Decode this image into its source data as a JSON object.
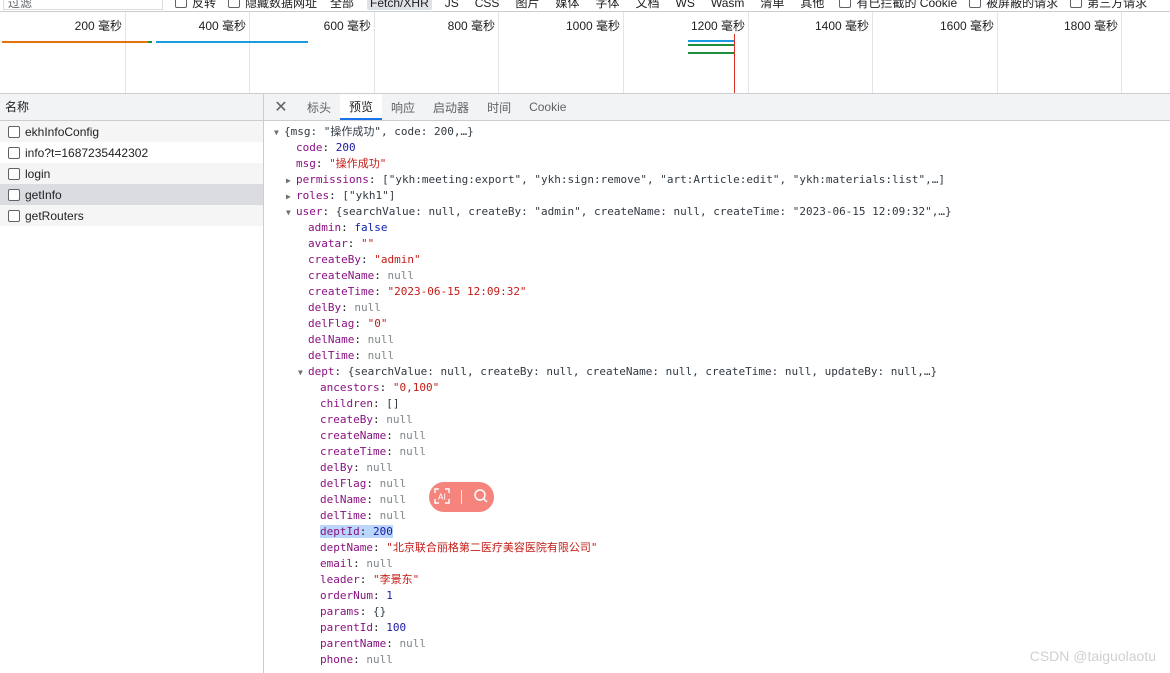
{
  "filter": {
    "placeholder": "过滤",
    "invert_label": "反转",
    "hide_data_urls_label": "隐藏数据网址",
    "types": [
      "全部",
      "Fetch/XHR",
      "JS",
      "CSS",
      "图片",
      "媒体",
      "字体",
      "文档",
      "WS",
      "Wasm",
      "清单",
      "其他"
    ],
    "selected_type": "Fetch/XHR",
    "blocked_cookies_label": "有已拦截的 Cookie",
    "blocked_requests_label": "被屏蔽的请求",
    "third_party_label": "第三方请求"
  },
  "overview": {
    "ticks": [
      "200 毫秒",
      "400 毫秒",
      "600 毫秒",
      "800 毫秒",
      "1000 毫秒",
      "1200 毫秒",
      "1400 毫秒",
      "1600 毫秒",
      "1800 毫秒"
    ],
    "colors": {
      "orange": "#e8710a",
      "blue": "#1a9ae0",
      "green": "#1e8e3e",
      "red": "#d93025"
    }
  },
  "requests": {
    "header": "名称",
    "items": [
      {
        "name": "ekhInfoConfig",
        "selected": false
      },
      {
        "name": "info?t=1687235442302",
        "selected": false
      },
      {
        "name": "login",
        "selected": false
      },
      {
        "name": "getInfo",
        "selected": true
      },
      {
        "name": "getRouters",
        "selected": false
      }
    ]
  },
  "tabs": {
    "close_icon": "close-icon",
    "items": [
      "标头",
      "预览",
      "响应",
      "启动器",
      "时间",
      "Cookie"
    ],
    "active": "预览"
  },
  "preview": {
    "lines": [
      {
        "indent": 0,
        "arrow": "down",
        "key": "",
        "summary": "{msg: \"操作成功\", code: 200,…}"
      },
      {
        "indent": 1,
        "arrow": "",
        "key": "code",
        "value": "200",
        "type": "num"
      },
      {
        "indent": 1,
        "arrow": "",
        "key": "msg",
        "value": "\"操作成功\"",
        "type": "str"
      },
      {
        "indent": 1,
        "arrow": "right",
        "key": "permissions",
        "summary": "[\"ykh:meeting:export\", \"ykh:sign:remove\", \"art:Article:edit\", \"ykh:materials:list\",…]"
      },
      {
        "indent": 1,
        "arrow": "right",
        "key": "roles",
        "summary": "[\"ykh1\"]"
      },
      {
        "indent": 1,
        "arrow": "down",
        "key": "user",
        "summary": "{searchValue: null, createBy: \"admin\", createName: null, createTime: \"2023-06-15 12:09:32\",…}"
      },
      {
        "indent": 2,
        "arrow": "",
        "key": "admin",
        "value": "false",
        "type": "bool"
      },
      {
        "indent": 2,
        "arrow": "",
        "key": "avatar",
        "value": "\"\"",
        "type": "str"
      },
      {
        "indent": 2,
        "arrow": "",
        "key": "createBy",
        "value": "\"admin\"",
        "type": "str"
      },
      {
        "indent": 2,
        "arrow": "",
        "key": "createName",
        "value": "null",
        "type": "null"
      },
      {
        "indent": 2,
        "arrow": "",
        "key": "createTime",
        "value": "\"2023-06-15 12:09:32\"",
        "type": "str"
      },
      {
        "indent": 2,
        "arrow": "",
        "key": "delBy",
        "value": "null",
        "type": "null"
      },
      {
        "indent": 2,
        "arrow": "",
        "key": "delFlag",
        "value": "\"0\"",
        "type": "str"
      },
      {
        "indent": 2,
        "arrow": "",
        "key": "delName",
        "value": "null",
        "type": "null"
      },
      {
        "indent": 2,
        "arrow": "",
        "key": "delTime",
        "value": "null",
        "type": "null"
      },
      {
        "indent": 2,
        "arrow": "down",
        "key": "dept",
        "summary": "{searchValue: null, createBy: null, createName: null, createTime: null, updateBy: null,…}"
      },
      {
        "indent": 3,
        "arrow": "",
        "key": "ancestors",
        "value": "\"0,100\"",
        "type": "str"
      },
      {
        "indent": 3,
        "arrow": "",
        "key": "children",
        "value": "[]",
        "type": "plain"
      },
      {
        "indent": 3,
        "arrow": "",
        "key": "createBy",
        "value": "null",
        "type": "null"
      },
      {
        "indent": 3,
        "arrow": "",
        "key": "createName",
        "value": "null",
        "type": "null"
      },
      {
        "indent": 3,
        "arrow": "",
        "key": "createTime",
        "value": "null",
        "type": "null"
      },
      {
        "indent": 3,
        "arrow": "",
        "key": "delBy",
        "value": "null",
        "type": "null"
      },
      {
        "indent": 3,
        "arrow": "",
        "key": "delFlag",
        "value": "null",
        "type": "null"
      },
      {
        "indent": 3,
        "arrow": "",
        "key": "delName",
        "value": "null",
        "type": "null"
      },
      {
        "indent": 3,
        "arrow": "",
        "key": "delTime",
        "value": "null",
        "type": "null"
      },
      {
        "indent": 3,
        "arrow": "",
        "key": "deptId",
        "value": "200",
        "type": "num",
        "highlight": true
      },
      {
        "indent": 3,
        "arrow": "",
        "key": "deptName",
        "value": "\"北京联合丽格第二医疗美容医院有限公司\"",
        "type": "str"
      },
      {
        "indent": 3,
        "arrow": "",
        "key": "email",
        "value": "null",
        "type": "null"
      },
      {
        "indent": 3,
        "arrow": "",
        "key": "leader",
        "value": "\"李景东\"",
        "type": "str"
      },
      {
        "indent": 3,
        "arrow": "",
        "key": "orderNum",
        "value": "1",
        "type": "num"
      },
      {
        "indent": 3,
        "arrow": "",
        "key": "params",
        "value": "{}",
        "type": "plain"
      },
      {
        "indent": 3,
        "arrow": "",
        "key": "parentId",
        "value": "100",
        "type": "num"
      },
      {
        "indent": 3,
        "arrow": "",
        "key": "parentName",
        "value": "null",
        "type": "null"
      },
      {
        "indent": 3,
        "arrow": "",
        "key": "phone",
        "value": "null",
        "type": "null"
      }
    ]
  },
  "floating_toolbar": {
    "icons": [
      "ai-scan-icon",
      "search-icon"
    ],
    "color": "#f5847c"
  },
  "watermark": "CSDN @taiguolaotu"
}
